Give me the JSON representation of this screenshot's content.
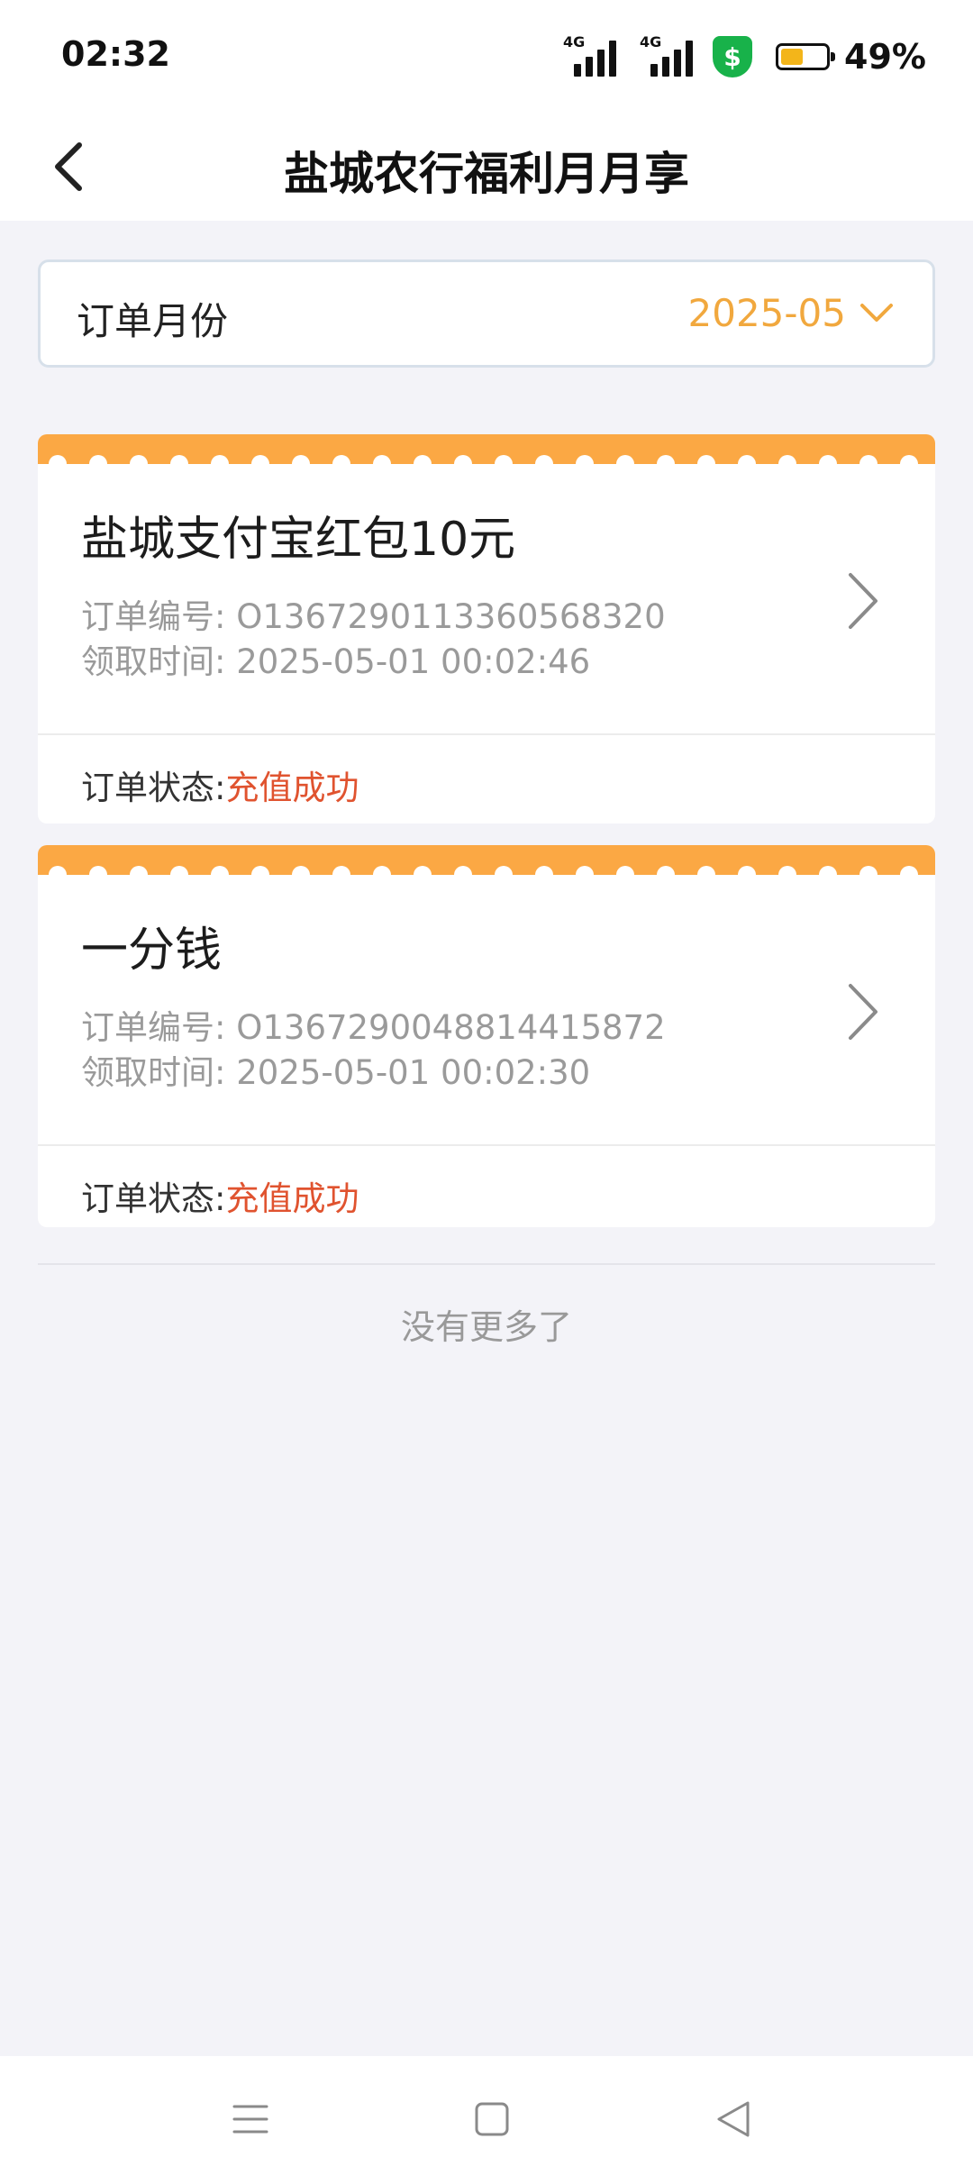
{
  "status_bar": {
    "time": "02:32",
    "signal1_label": "4G",
    "signal2_label": "4G",
    "battery_text": "49%",
    "battery_level": 0.49,
    "shield_symbol": "$",
    "colors": {
      "shield": "#18b24a",
      "battery_fill": "#f3b51a"
    }
  },
  "nav": {
    "title": "盐城农行福利月月享",
    "back_icon": "chevron-left-icon"
  },
  "filter": {
    "label": "订单月份",
    "value": "2025-05",
    "dropdown_icon": "chevron-down-icon",
    "accent_color": "#f1a83e"
  },
  "orders": [
    {
      "title": "盐城支付宝红包10元",
      "order_no_label": "订单编号:",
      "order_no": "O1367290113360568320",
      "time_label": "领取时间:",
      "time": "2025-05-01 00:02:46",
      "status_label": "订单状态:",
      "status": "充值成功"
    },
    {
      "title": "一分钱",
      "order_no_label": "订单编号:",
      "order_no": "O1367290048814415872",
      "time_label": "领取时间:",
      "time": "2025-05-01 00:02:30",
      "status_label": "订单状态:",
      "status": "充值成功"
    }
  ],
  "list_end_text": "没有更多了",
  "colors": {
    "card_header": "#fba844",
    "status_success": "#e0532f"
  },
  "system_nav": {
    "icons": [
      "menu-icon",
      "home-square-icon",
      "back-triangle-icon"
    ]
  }
}
